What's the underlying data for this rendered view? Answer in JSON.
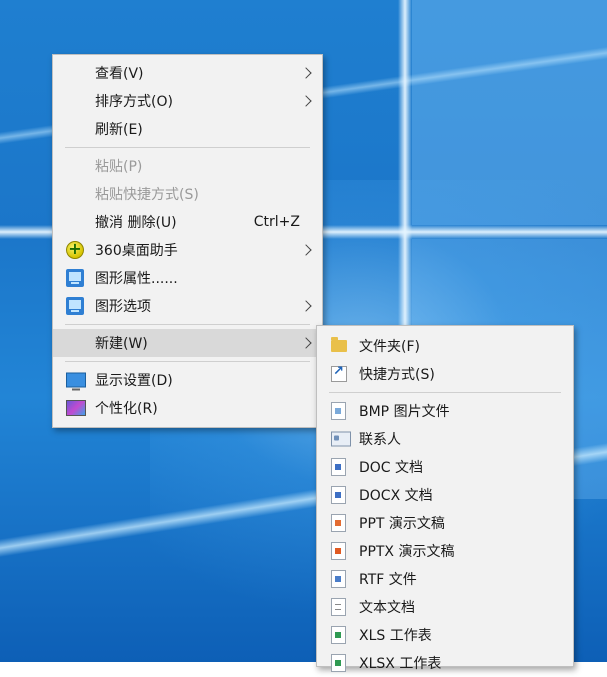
{
  "desktop": {
    "background": "#1f7fd0"
  },
  "context_menu": {
    "items": [
      {
        "label": "查看(V)",
        "submenu": true
      },
      {
        "label": "排序方式(O)",
        "submenu": true
      },
      {
        "label": "刷新(E)"
      },
      {
        "label": "粘贴(P)",
        "disabled": true
      },
      {
        "label": "粘贴快捷方式(S)",
        "disabled": true
      },
      {
        "label": "撤消 删除(U)",
        "shortcut": "Ctrl+Z"
      },
      {
        "label": "360桌面助手",
        "icon": "360-icon",
        "submenu": true
      },
      {
        "label": "图形属性......",
        "icon": "graphics-icon"
      },
      {
        "label": "图形选项",
        "icon": "graphics-icon",
        "submenu": true
      },
      {
        "label": "新建(W)",
        "submenu": true,
        "highlighted": true
      },
      {
        "label": "显示设置(D)",
        "icon": "display-icon"
      },
      {
        "label": "个性化(R)",
        "icon": "personalize-icon"
      }
    ]
  },
  "new_submenu": {
    "items": [
      {
        "label": "文件夹(F)",
        "icon": "folder-icon"
      },
      {
        "label": "快捷方式(S)",
        "icon": "shortcut-icon"
      },
      {
        "label": "BMP 图片文件",
        "icon": "bmp-file-icon"
      },
      {
        "label": "联系人",
        "icon": "contact-icon"
      },
      {
        "label": "DOC 文档",
        "icon": "doc-file-icon"
      },
      {
        "label": "DOCX 文档",
        "icon": "docx-file-icon"
      },
      {
        "label": "PPT 演示文稿",
        "icon": "ppt-file-icon"
      },
      {
        "label": "PPTX 演示文稿",
        "icon": "pptx-file-icon"
      },
      {
        "label": "RTF 文件",
        "icon": "rtf-file-icon"
      },
      {
        "label": "文本文档",
        "icon": "txt-file-icon"
      },
      {
        "label": "XLS 工作表",
        "icon": "xls-file-icon"
      },
      {
        "label": "XLSX 工作表",
        "icon": "xlsx-file-icon"
      }
    ]
  }
}
